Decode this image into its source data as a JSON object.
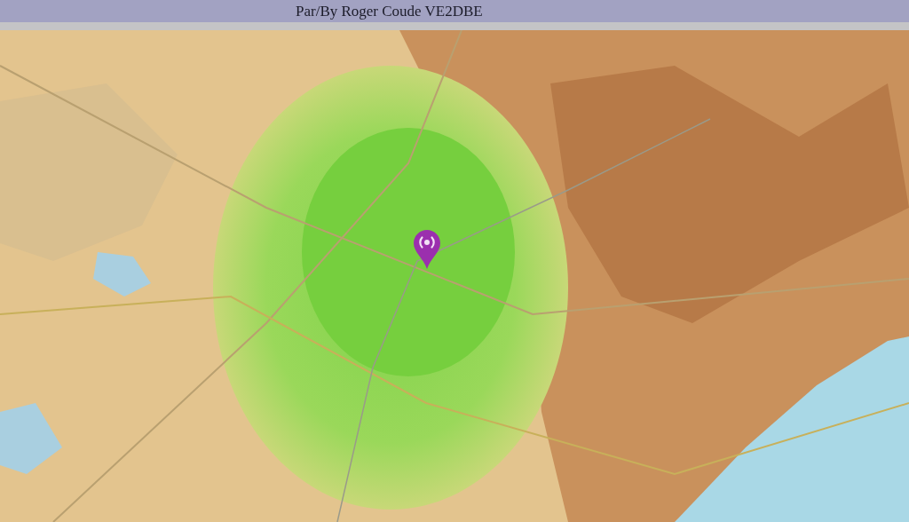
{
  "header": {
    "credit": "Par/By Roger Coude VE2DBE"
  }
}
